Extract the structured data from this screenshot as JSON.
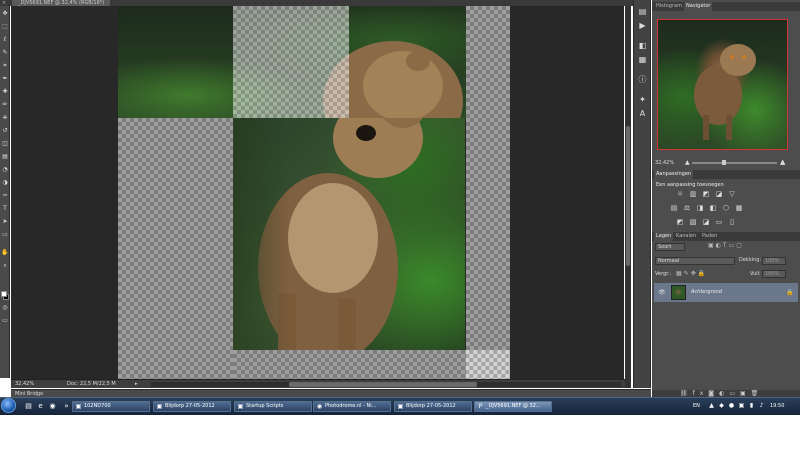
{
  "document": {
    "tab_title": "_DJV5691.NEF @ 32,4% (RGB/16*)",
    "zoom": "32,42%",
    "doc_size": "Doc: 22,5 M/22,5 M"
  },
  "tools": {
    "icons": [
      "move-icon",
      "marquee-icon",
      "lasso-icon",
      "quick-select-icon",
      "crop-icon",
      "eyedropper-icon",
      "healing-icon",
      "brush-icon",
      "stamp-icon",
      "history-brush-icon",
      "eraser-icon",
      "gradient-icon",
      "blur-icon",
      "dodge-icon",
      "pen-icon",
      "type-icon",
      "path-select-icon",
      "shape-icon",
      "hand-icon",
      "zoom-icon"
    ],
    "glyphs": [
      "✥",
      "⬚",
      "ℓ",
      "✎",
      "⌗",
      "✒",
      "✚",
      "✏",
      "⎈",
      "↺",
      "◫",
      "▤",
      "◔",
      "◑",
      "✑",
      "T",
      "➤",
      "▭",
      "✋",
      "⌕"
    ],
    "fg_color": "#ffffff",
    "bg_color": "#000000"
  },
  "icon_strip": {
    "icons": [
      "history-panel-icon",
      "actions-icon",
      "color-icon",
      "swatches-icon",
      "info-icon",
      "brush-presets-icon",
      "character-icon"
    ],
    "glyphs": [
      "▤",
      "▶",
      "◧",
      "▦",
      "ⓘ",
      "✦",
      "A"
    ]
  },
  "navigator": {
    "tabs": [
      "Histogram",
      "Navigator"
    ],
    "active_tab": "Navigator",
    "zoom": "32,42%",
    "accent": "#d33333"
  },
  "adjustments": {
    "tabs": [
      "Aanpassingen"
    ],
    "hint": "Een aanpassing toevoegen",
    "row1": [
      "☼",
      "▥",
      "◩",
      "◪",
      "▽"
    ],
    "row2": [
      "▤",
      "⚖",
      "◨",
      "◧",
      "⬡",
      "▦"
    ],
    "row3": [
      "◩",
      "▧",
      "◪",
      "▭",
      "▯"
    ]
  },
  "layers": {
    "tabs": [
      "Lagen",
      "Kanalen",
      "Paden"
    ],
    "active_tab": "Lagen",
    "filter": "Soort",
    "blend_mode": "Normaal",
    "opacity_label": "Dekking:",
    "opacity_value": "100%",
    "lock_label": "Vergr.:",
    "fill_label": "Vull:",
    "fill_value": "100%",
    "layer_name": "Achtergrond",
    "selected_color": "#6b778a"
  },
  "mini_bridge": {
    "label": "Mini Bridge"
  },
  "taskbar": {
    "apps": [
      {
        "label": "102ND700",
        "icon": "▣"
      },
      {
        "label": "Blijdorp 27-05-2012",
        "icon": "▣"
      },
      {
        "label": "Startup Scripts",
        "icon": "▣"
      },
      {
        "label": "Photodrome.nl - Ni...",
        "icon": "◉"
      },
      {
        "label": "Blijdorp 27-05-2012",
        "icon": "▣"
      },
      {
        "label": "_DJV5691.NEF @ 32...",
        "icon": "P"
      }
    ],
    "lang": "EN",
    "time": "19:50"
  }
}
